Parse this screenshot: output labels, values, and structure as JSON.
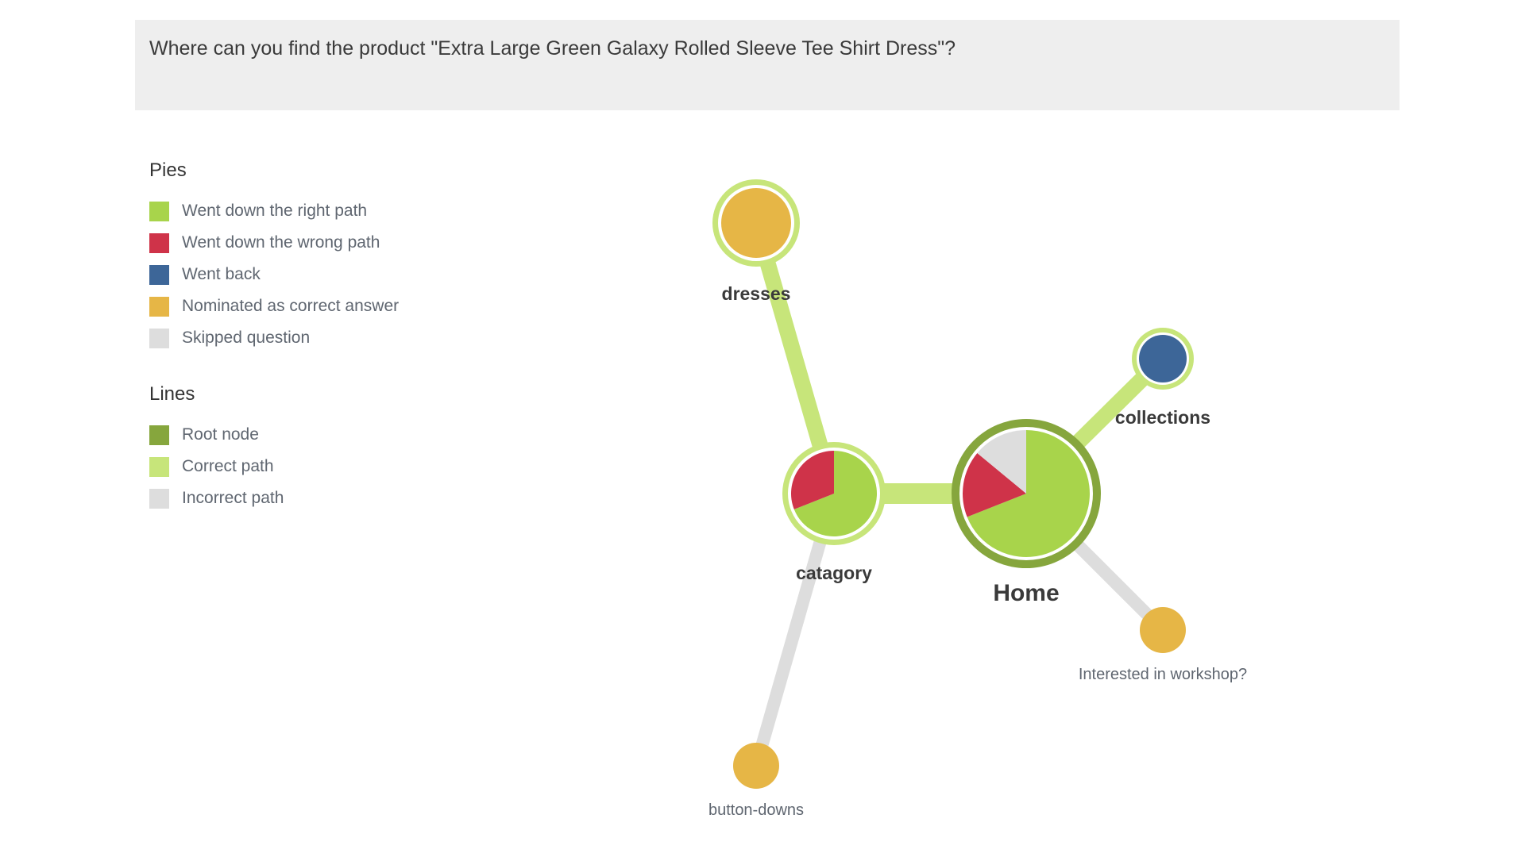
{
  "question": {
    "text": "Where can you find the product \"Extra Large Green Galaxy Rolled Sleeve Tee Shirt Dress\"?"
  },
  "legend": {
    "pies_title": "Pies",
    "pies": [
      {
        "label": "Went down the right path",
        "color": "#a8d44b"
      },
      {
        "label": "Went down the wrong path",
        "color": "#cf3349"
      },
      {
        "label": "Went back",
        "color": "#3d6698"
      },
      {
        "label": "Nominated as correct answer",
        "color": "#e6b646"
      },
      {
        "label": "Skipped question",
        "color": "#dddddd"
      }
    ],
    "lines_title": "Lines",
    "lines": [
      {
        "label": "Root node",
        "color": "#86a63d"
      },
      {
        "label": "Correct path",
        "color": "#c7e57a"
      },
      {
        "label": "Incorrect path",
        "color": "#dddddd"
      }
    ]
  },
  "tree": {
    "nodes": [
      {
        "id": "home",
        "label": "Home",
        "root": true,
        "ring": "root",
        "slices": [
          {
            "kind": "right",
            "value": 69
          },
          {
            "kind": "wrong",
            "value": 17
          },
          {
            "kind": "skipped",
            "value": 14
          }
        ]
      },
      {
        "id": "catagory",
        "label": "catagory",
        "ring": "correct",
        "slices": [
          {
            "kind": "right",
            "value": 69
          },
          {
            "kind": "wrong",
            "value": 31
          }
        ]
      },
      {
        "id": "dresses",
        "label": "dresses",
        "ring": "correct",
        "slices": [
          {
            "kind": "nominated",
            "value": 100
          }
        ]
      },
      {
        "id": "collections",
        "label": "collections",
        "ring": "correct",
        "slices": [
          {
            "kind": "back",
            "value": 100
          }
        ]
      },
      {
        "id": "workshop",
        "label": "Interested in workshop?",
        "ring": "none",
        "slices": [
          {
            "kind": "nominated",
            "value": 100
          }
        ]
      },
      {
        "id": "button-downs",
        "label": "button-downs",
        "ring": "none",
        "slices": [
          {
            "kind": "nominated",
            "value": 100
          }
        ]
      }
    ],
    "edges": [
      {
        "from": "home",
        "to": "catagory",
        "type": "correct"
      },
      {
        "from": "catagory",
        "to": "dresses",
        "type": "correct"
      },
      {
        "from": "home",
        "to": "collections",
        "type": "correct"
      },
      {
        "from": "home",
        "to": "workshop",
        "type": "incorrect"
      },
      {
        "from": "catagory",
        "to": "button-downs",
        "type": "incorrect"
      }
    ]
  }
}
